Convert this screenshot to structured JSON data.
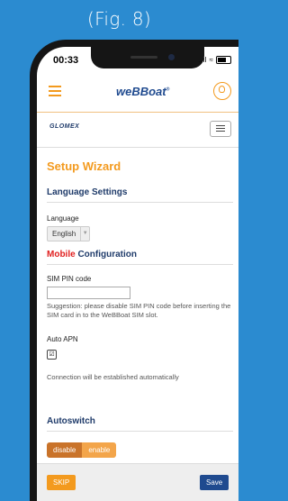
{
  "figure_label": "(Fig. 8)",
  "status_bar": {
    "time": "00:33",
    "signal": "..ıl",
    "wifi": "≈"
  },
  "app": {
    "logo": "weBBoat",
    "sub_logo": "GLOMEX"
  },
  "wizard": {
    "title": "Setup Wizard",
    "language_section": "Language Settings",
    "language_label": "Language",
    "language_value": "English",
    "mobile_section_red": "Mobile",
    "mobile_section_rest": "Configuration",
    "sim_pin_label": "SIM PIN code",
    "sim_pin_value": "",
    "sim_suggestion": "Suggestion: please disable SIM PIN code before inserting the SIM card in to the WeBBoat SIM slot.",
    "auto_apn_label": "Auto APN",
    "auto_apn_checked": "☑",
    "connection_note": "Connection will be established automatically",
    "autoswitch_section": "Autoswitch",
    "toggle_disable": "disable",
    "toggle_enable": "enable"
  },
  "footer": {
    "skip_label": "SKIP",
    "save_label": "Save"
  },
  "colors": {
    "accent": "#f39a1e",
    "brand": "#1f4a8f",
    "background": "#2b8bd0"
  }
}
